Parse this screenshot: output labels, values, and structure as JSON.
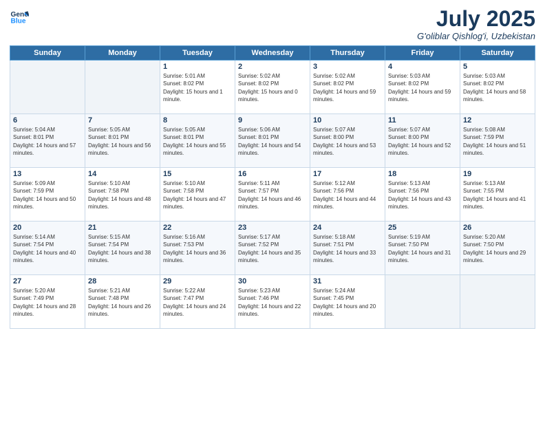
{
  "header": {
    "logo_line1": "General",
    "logo_line2": "Blue",
    "month_year": "July 2025",
    "location": "G'oliblar Qishlog'i, Uzbekistan"
  },
  "weekdays": [
    "Sunday",
    "Monday",
    "Tuesday",
    "Wednesday",
    "Thursday",
    "Friday",
    "Saturday"
  ],
  "weeks": [
    [
      {
        "day": "",
        "empty": true
      },
      {
        "day": "",
        "empty": true
      },
      {
        "day": "1",
        "sunrise": "5:01 AM",
        "sunset": "8:02 PM",
        "daylight": "15 hours and 1 minute."
      },
      {
        "day": "2",
        "sunrise": "5:02 AM",
        "sunset": "8:02 PM",
        "daylight": "15 hours and 0 minutes."
      },
      {
        "day": "3",
        "sunrise": "5:02 AM",
        "sunset": "8:02 PM",
        "daylight": "14 hours and 59 minutes."
      },
      {
        "day": "4",
        "sunrise": "5:03 AM",
        "sunset": "8:02 PM",
        "daylight": "14 hours and 59 minutes."
      },
      {
        "day": "5",
        "sunrise": "5:03 AM",
        "sunset": "8:02 PM",
        "daylight": "14 hours and 58 minutes."
      }
    ],
    [
      {
        "day": "6",
        "sunrise": "5:04 AM",
        "sunset": "8:01 PM",
        "daylight": "14 hours and 57 minutes."
      },
      {
        "day": "7",
        "sunrise": "5:05 AM",
        "sunset": "8:01 PM",
        "daylight": "14 hours and 56 minutes."
      },
      {
        "day": "8",
        "sunrise": "5:05 AM",
        "sunset": "8:01 PM",
        "daylight": "14 hours and 55 minutes."
      },
      {
        "day": "9",
        "sunrise": "5:06 AM",
        "sunset": "8:01 PM",
        "daylight": "14 hours and 54 minutes."
      },
      {
        "day": "10",
        "sunrise": "5:07 AM",
        "sunset": "8:00 PM",
        "daylight": "14 hours and 53 minutes."
      },
      {
        "day": "11",
        "sunrise": "5:07 AM",
        "sunset": "8:00 PM",
        "daylight": "14 hours and 52 minutes."
      },
      {
        "day": "12",
        "sunrise": "5:08 AM",
        "sunset": "7:59 PM",
        "daylight": "14 hours and 51 minutes."
      }
    ],
    [
      {
        "day": "13",
        "sunrise": "5:09 AM",
        "sunset": "7:59 PM",
        "daylight": "14 hours and 50 minutes."
      },
      {
        "day": "14",
        "sunrise": "5:10 AM",
        "sunset": "7:58 PM",
        "daylight": "14 hours and 48 minutes."
      },
      {
        "day": "15",
        "sunrise": "5:10 AM",
        "sunset": "7:58 PM",
        "daylight": "14 hours and 47 minutes."
      },
      {
        "day": "16",
        "sunrise": "5:11 AM",
        "sunset": "7:57 PM",
        "daylight": "14 hours and 46 minutes."
      },
      {
        "day": "17",
        "sunrise": "5:12 AM",
        "sunset": "7:56 PM",
        "daylight": "14 hours and 44 minutes."
      },
      {
        "day": "18",
        "sunrise": "5:13 AM",
        "sunset": "7:56 PM",
        "daylight": "14 hours and 43 minutes."
      },
      {
        "day": "19",
        "sunrise": "5:13 AM",
        "sunset": "7:55 PM",
        "daylight": "14 hours and 41 minutes."
      }
    ],
    [
      {
        "day": "20",
        "sunrise": "5:14 AM",
        "sunset": "7:54 PM",
        "daylight": "14 hours and 40 minutes."
      },
      {
        "day": "21",
        "sunrise": "5:15 AM",
        "sunset": "7:54 PM",
        "daylight": "14 hours and 38 minutes."
      },
      {
        "day": "22",
        "sunrise": "5:16 AM",
        "sunset": "7:53 PM",
        "daylight": "14 hours and 36 minutes."
      },
      {
        "day": "23",
        "sunrise": "5:17 AM",
        "sunset": "7:52 PM",
        "daylight": "14 hours and 35 minutes."
      },
      {
        "day": "24",
        "sunrise": "5:18 AM",
        "sunset": "7:51 PM",
        "daylight": "14 hours and 33 minutes."
      },
      {
        "day": "25",
        "sunrise": "5:19 AM",
        "sunset": "7:50 PM",
        "daylight": "14 hours and 31 minutes."
      },
      {
        "day": "26",
        "sunrise": "5:20 AM",
        "sunset": "7:50 PM",
        "daylight": "14 hours and 29 minutes."
      }
    ],
    [
      {
        "day": "27",
        "sunrise": "5:20 AM",
        "sunset": "7:49 PM",
        "daylight": "14 hours and 28 minutes."
      },
      {
        "day": "28",
        "sunrise": "5:21 AM",
        "sunset": "7:48 PM",
        "daylight": "14 hours and 26 minutes."
      },
      {
        "day": "29",
        "sunrise": "5:22 AM",
        "sunset": "7:47 PM",
        "daylight": "14 hours and 24 minutes."
      },
      {
        "day": "30",
        "sunrise": "5:23 AM",
        "sunset": "7:46 PM",
        "daylight": "14 hours and 22 minutes."
      },
      {
        "day": "31",
        "sunrise": "5:24 AM",
        "sunset": "7:45 PM",
        "daylight": "14 hours and 20 minutes."
      },
      {
        "day": "",
        "empty": true
      },
      {
        "day": "",
        "empty": true
      }
    ]
  ],
  "labels": {
    "sunrise": "Sunrise:",
    "sunset": "Sunset:",
    "daylight": "Daylight:"
  }
}
